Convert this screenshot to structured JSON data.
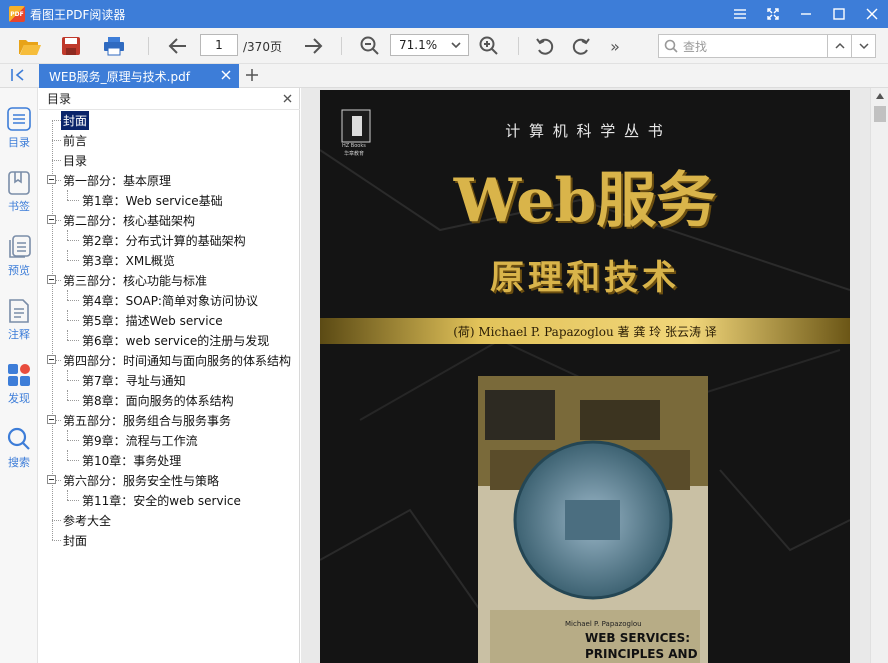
{
  "app": {
    "title": "看图王PDF阅读器",
    "logo_text": "PDF"
  },
  "toolbar": {
    "page_current": "1",
    "page_total": "/370页",
    "zoom": "71.1%",
    "search_placeholder": "查找",
    "more_label": "»"
  },
  "tab": {
    "filename": "WEB服务_原理与技术.pdf"
  },
  "rail": [
    {
      "label": "目录",
      "icon": "list-icon"
    },
    {
      "label": "书签",
      "icon": "bookmark-icon"
    },
    {
      "label": "预览",
      "icon": "pages-icon"
    },
    {
      "label": "注释",
      "icon": "note-icon"
    },
    {
      "label": "发现",
      "icon": "discover-icon"
    },
    {
      "label": "搜索",
      "icon": "search-icon"
    }
  ],
  "outline": {
    "title": "目录",
    "items": [
      {
        "label": "封面"
      },
      {
        "label": "前言"
      },
      {
        "label": "目录"
      },
      {
        "label": "第一部分：基本原理"
      },
      {
        "label": "第1章：Web service基础"
      },
      {
        "label": "第二部分：核心基础架构"
      },
      {
        "label": "第2章：分布式计算的基础架构"
      },
      {
        "label": "第3章：XML概览"
      },
      {
        "label": "第三部分：核心功能与标准"
      },
      {
        "label": "第4章：SOAP:简单对象访问协议"
      },
      {
        "label": "第5章：描述Web service"
      },
      {
        "label": "第6章：web service的注册与发现"
      },
      {
        "label": "第四部分：时间通知与面向服务的体系结构"
      },
      {
        "label": "第7章：寻址与通知"
      },
      {
        "label": "第8章：面向服务的体系结构"
      },
      {
        "label": "第五部分：服务组合与服务事务"
      },
      {
        "label": "第9章：流程与工作流"
      },
      {
        "label": "第10章：事务处理"
      },
      {
        "label": "第六部分：服务安全性与策略"
      },
      {
        "label": "第11章：安全的web service"
      },
      {
        "label": "参考大全"
      },
      {
        "label": "封面"
      }
    ]
  },
  "cover": {
    "series": "计 算 机 科 学 丛 书",
    "publisher_logo": "HZ Books",
    "publisher_cn": "华章教育",
    "title_main": "Web服务",
    "title_sub": "原理和技术",
    "authors": "(荷) Michael P. Papazoglou 著   龚 玲  张云涛 译",
    "inset_author": "Michael P. Papazoglou",
    "inset_title_1": "WEB SERVICES:",
    "inset_title_2": "PRINCIPLES AND"
  },
  "colors": {
    "accent": "#3d7dd8",
    "gold": "#d9b44a",
    "cover_bg": "#111111"
  }
}
